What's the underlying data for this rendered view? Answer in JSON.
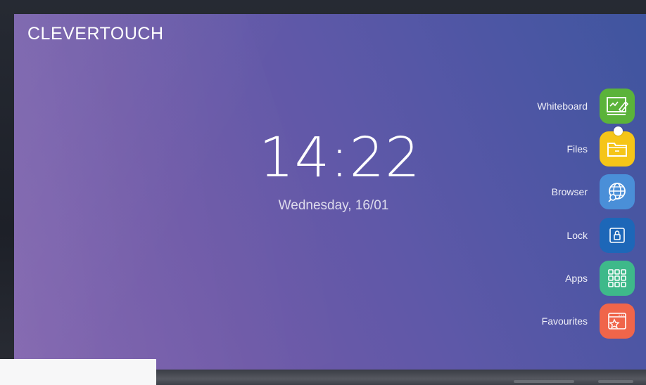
{
  "brand": "CLEVERTOUCH",
  "clock": {
    "time": "14:22",
    "date": "Wednesday, 16/01"
  },
  "dock": [
    {
      "label": "Whiteboard",
      "icon": "whiteboard-icon",
      "color": "#5bb33a"
    },
    {
      "label": "Files",
      "icon": "folder-icon",
      "color": "#f5c518"
    },
    {
      "label": "Browser",
      "icon": "globe-icon",
      "color": "#4a8fd8"
    },
    {
      "label": "Lock",
      "icon": "lock-icon",
      "color": "#1d67b8"
    },
    {
      "label": "Apps",
      "icon": "apps-grid-icon",
      "color": "#3eb98a"
    },
    {
      "label": "Favourites",
      "icon": "favourites-icon",
      "color": "#f0654a"
    }
  ],
  "colors": {
    "background_start": "#7f62ad",
    "background_end": "#3f559f"
  }
}
